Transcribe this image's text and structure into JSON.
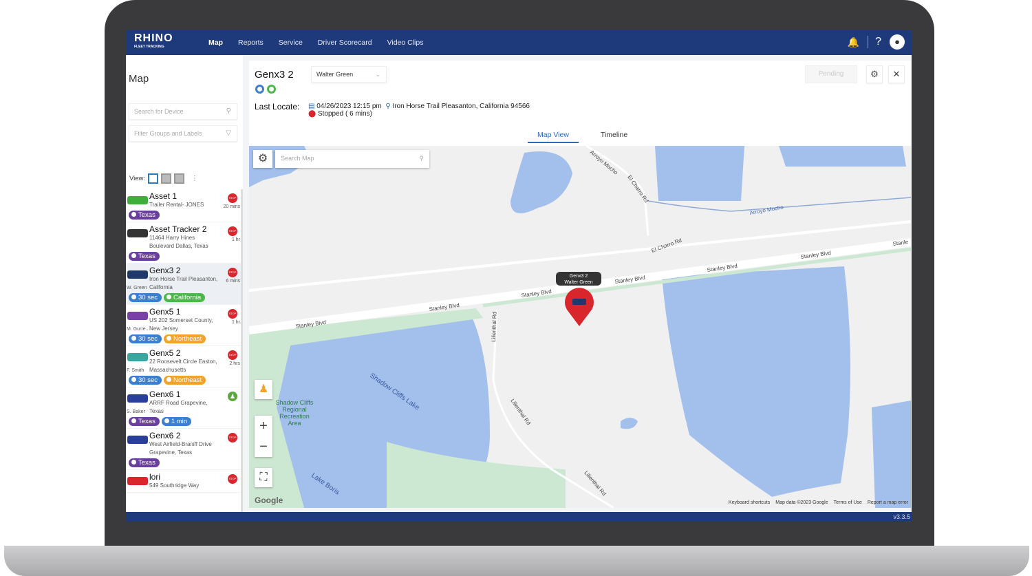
{
  "nav": {
    "logo": "RHINO",
    "logo_sub": "FLEET TRACKING",
    "items": [
      "Map",
      "Reports",
      "Service",
      "Driver Scorecard",
      "Video Clips"
    ],
    "active": "Map",
    "help": "?"
  },
  "sidebar": {
    "title": "Map",
    "search_placeholder": "Search for Device",
    "filter_placeholder": "Filter Groups and Labels",
    "view_label": "View:",
    "items": [
      {
        "name": "Asset 1",
        "address": "Trailer Rental- JONES",
        "driver": "",
        "time": "20 mins",
        "status": "stopped",
        "color": "#3fae3a",
        "tags": [
          {
            "label": "Texas",
            "color": "#6b3fa0"
          }
        ]
      },
      {
        "name": "Asset Tracker 2",
        "address": "11464 Harry Hines Boulevard Dallas, Texas",
        "driver": "",
        "time": "1 hr",
        "status": "stopped",
        "color": "#333333",
        "tags": [
          {
            "label": "Texas",
            "color": "#6b3fa0"
          }
        ]
      },
      {
        "name": "Genx3 2",
        "address": "Iron Horse Trail Pleasanton, California",
        "driver": "W. Green",
        "time": "6 mins",
        "status": "stopped",
        "color": "#1f3a6a",
        "selected": true,
        "tags": [
          {
            "label": "30 sec",
            "color": "#3a7fd0"
          },
          {
            "label": "California",
            "color": "#4cb84a"
          }
        ]
      },
      {
        "name": "Genx5 1",
        "address": "US 202 Somerset County, New Jersey",
        "driver": "M. Gurre...",
        "time": "1 hr",
        "status": "stopped",
        "color": "#7b3fa8",
        "tags": [
          {
            "label": "30 sec",
            "color": "#3a7fd0"
          },
          {
            "label": "Northeast",
            "color": "#f2a42a"
          }
        ]
      },
      {
        "name": "Genx5 2",
        "address": "22 Roosevelt Circle Easton, Massachusetts",
        "driver": "F. Smith",
        "time": "2 hrs",
        "status": "stopped",
        "color": "#3aa6a0",
        "tags": [
          {
            "label": "30 sec",
            "color": "#3a7fd0"
          },
          {
            "label": "Northeast",
            "color": "#f2a42a"
          }
        ]
      },
      {
        "name": "Genx6 1",
        "address": "ARRF Road Grapevine, Texas",
        "driver": "S. Baker",
        "time": "",
        "status": "moving",
        "color": "#2a3f9a",
        "tags": [
          {
            "label": "Texas",
            "color": "#6b3fa0"
          },
          {
            "label": "1 min",
            "color": "#3a7fd0"
          }
        ]
      },
      {
        "name": "Genx6 2",
        "address": "West Airfield-Braniff Drive Grapevine, Texas",
        "driver": "",
        "time": "",
        "status": "stopped",
        "color": "#2a3f9a",
        "tags": [
          {
            "label": "Texas",
            "color": "#6b3fa0"
          }
        ]
      },
      {
        "name": "lori",
        "address": "549 Southridge Way",
        "driver": "",
        "time": "",
        "status": "stopped",
        "color": "#d9262c",
        "tags": []
      }
    ],
    "stop_label": "STOP"
  },
  "detail": {
    "title": "Genx3 2",
    "driver": "Walter Green",
    "pending": "Pending",
    "last_locate_label": "Last Locate:",
    "datetime": "04/26/2023 12:15 pm",
    "location": "Iron Horse Trail Pleasanton, California 94566",
    "status": "Stopped ( 6 mins)",
    "tabs": [
      "Map View",
      "Timeline"
    ],
    "active_tab": "Map View"
  },
  "map": {
    "search_placeholder": "Search Map",
    "marker_label_1": "Genx3 2",
    "marker_label_2": "Walter Green",
    "labels": [
      "Arroyo Mocho",
      "El Charro Rd",
      "Arroyo Mocho",
      "El Charro Rd",
      "Stanley Blvd",
      "Stanley Blvd",
      "Stanley Blvd",
      "Stanley Blvd",
      "Stanley Blvd",
      "Stanley Blvd",
      "Stanle",
      "Lilienthal Rd",
      "Lilienthal Rd",
      "Lilienthal Rd",
      "Shadow Cliffs Lake",
      "Lake Boris"
    ],
    "park": [
      "Shadow Cliffs",
      "Regional",
      "Recreation",
      "Area"
    ],
    "footer": [
      "Keyboard shortcuts",
      "Map data ©2023 Google",
      "Terms of Use",
      "Report a map error"
    ],
    "google": "Google",
    "water_color": "#a3c0ec",
    "park_color": "#cde8d2"
  },
  "footer": {
    "version": "v3.3.5"
  }
}
